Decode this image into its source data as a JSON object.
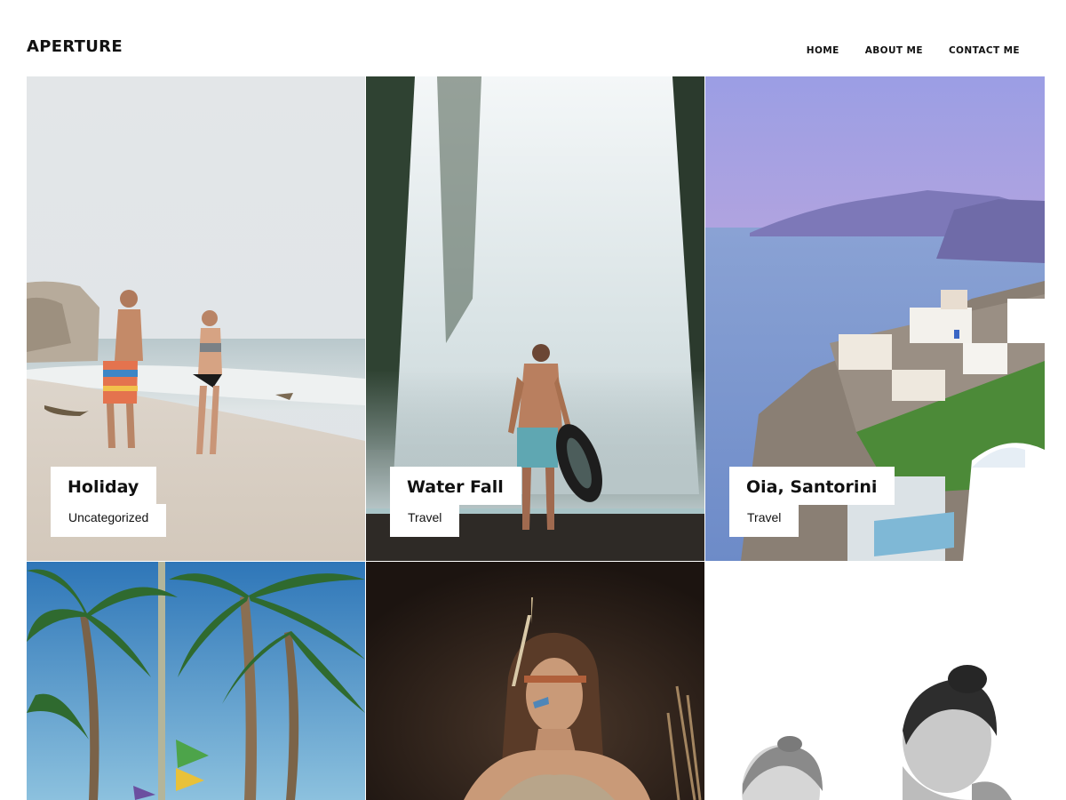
{
  "site": {
    "logo": "APERTURE"
  },
  "nav": [
    {
      "label": "HOME"
    },
    {
      "label": "ABOUT ME"
    },
    {
      "label": "CONTACT ME"
    }
  ],
  "posts": [
    {
      "title": "Holiday",
      "category": "Uncategorized",
      "photo": "couple-on-beach"
    },
    {
      "title": "Water Fall",
      "category": "Travel",
      "photo": "man-at-waterfall"
    },
    {
      "title": "Oia, Santorini",
      "category": "Travel",
      "photo": "santorini-coast"
    },
    {
      "photo": "palm-trees"
    },
    {
      "photo": "woman-with-feathers"
    },
    {
      "photo": "black-white-couple"
    }
  ]
}
